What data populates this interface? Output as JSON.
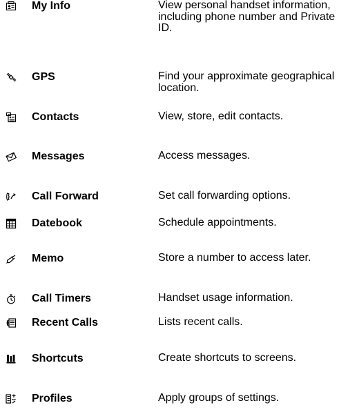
{
  "menu": {
    "items": [
      {
        "label": "My Info",
        "description": "View personal handset information, including phone number and Private ID.",
        "icon": "id-card-icon"
      },
      {
        "label": "GPS",
        "description": "Find your approximate geographical location.",
        "icon": "satellite-icon"
      },
      {
        "label": "Contacts",
        "description": "View, store, edit contacts.",
        "icon": "contacts-card-icon"
      },
      {
        "label": "Messages",
        "description": "Access messages.",
        "icon": "envelope-icon"
      },
      {
        "label": "Call Forward",
        "description": "Set call forwarding options.",
        "icon": "call-forward-icon"
      },
      {
        "label": "Datebook",
        "description": "Schedule appointments.",
        "icon": "calendar-grid-icon"
      },
      {
        "label": "Memo",
        "description": "Store a number to access later.",
        "icon": "memo-pen-icon"
      },
      {
        "label": "Call Timers",
        "description": "Handset usage information.",
        "icon": "stopwatch-icon"
      },
      {
        "label": "Recent Calls",
        "description": "Lists recent calls.",
        "icon": "recent-calls-icon"
      },
      {
        "label": "Shortcuts",
        "description": "Create shortcuts to screens.",
        "icon": "shortcut-icon"
      },
      {
        "label": "Profiles",
        "description": "Apply groups of settings.",
        "icon": "profiles-icon"
      }
    ]
  }
}
